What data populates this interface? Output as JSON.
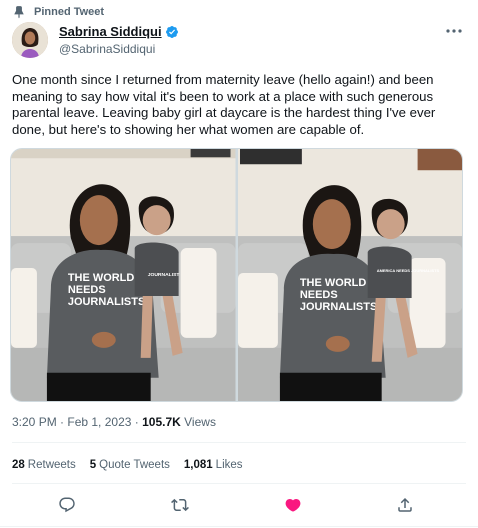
{
  "pinned": {
    "label": "Pinned Tweet"
  },
  "author": {
    "name": "Sabrina Siddiqui",
    "handle": "@SabrinaSiddiqui",
    "verified": true,
    "avatar_icon": "profile-photo"
  },
  "tweet": {
    "text": "One month since I returned from maternity leave (hello again!) and been meaning to say how vital it's been to work at a place with such generous parental leave. Leaving baby girl at daycare is the hardest thing I've ever done, but here's to showing her what women are capable of."
  },
  "media": {
    "photos": [
      {
        "shirt_text": [
          "THE WORLD",
          "NEEDS",
          "JOURNALISTS"
        ],
        "baby_shirt_text": "JOURNALIST"
      },
      {
        "shirt_text": [
          "THE WORLD",
          "NEEDS",
          "JOURNALISTS"
        ],
        "baby_shirt_text": "AMERICA NEEDS JOURNALISTS"
      }
    ]
  },
  "meta": {
    "time": "3:20 PM",
    "separator": " · ",
    "date": "Feb 1, 2023",
    "separator2": " · ",
    "views_count": "105.7K",
    "views_label": " Views"
  },
  "stats": {
    "retweets_count": "28",
    "retweets_label": "Retweets",
    "quotes_count": "5",
    "quotes_label": "Quote Tweets",
    "likes_count": "1,081",
    "likes_label": "Likes"
  },
  "actions": {
    "reply_icon": "comment-icon",
    "retweet_icon": "retweet-icon",
    "like_icon": "heart-icon",
    "share_icon": "share-icon"
  },
  "colors": {
    "like": "#f91880",
    "secondary_text": "#536471",
    "verified": "#1d9bf0",
    "divider": "#eff3f4"
  }
}
